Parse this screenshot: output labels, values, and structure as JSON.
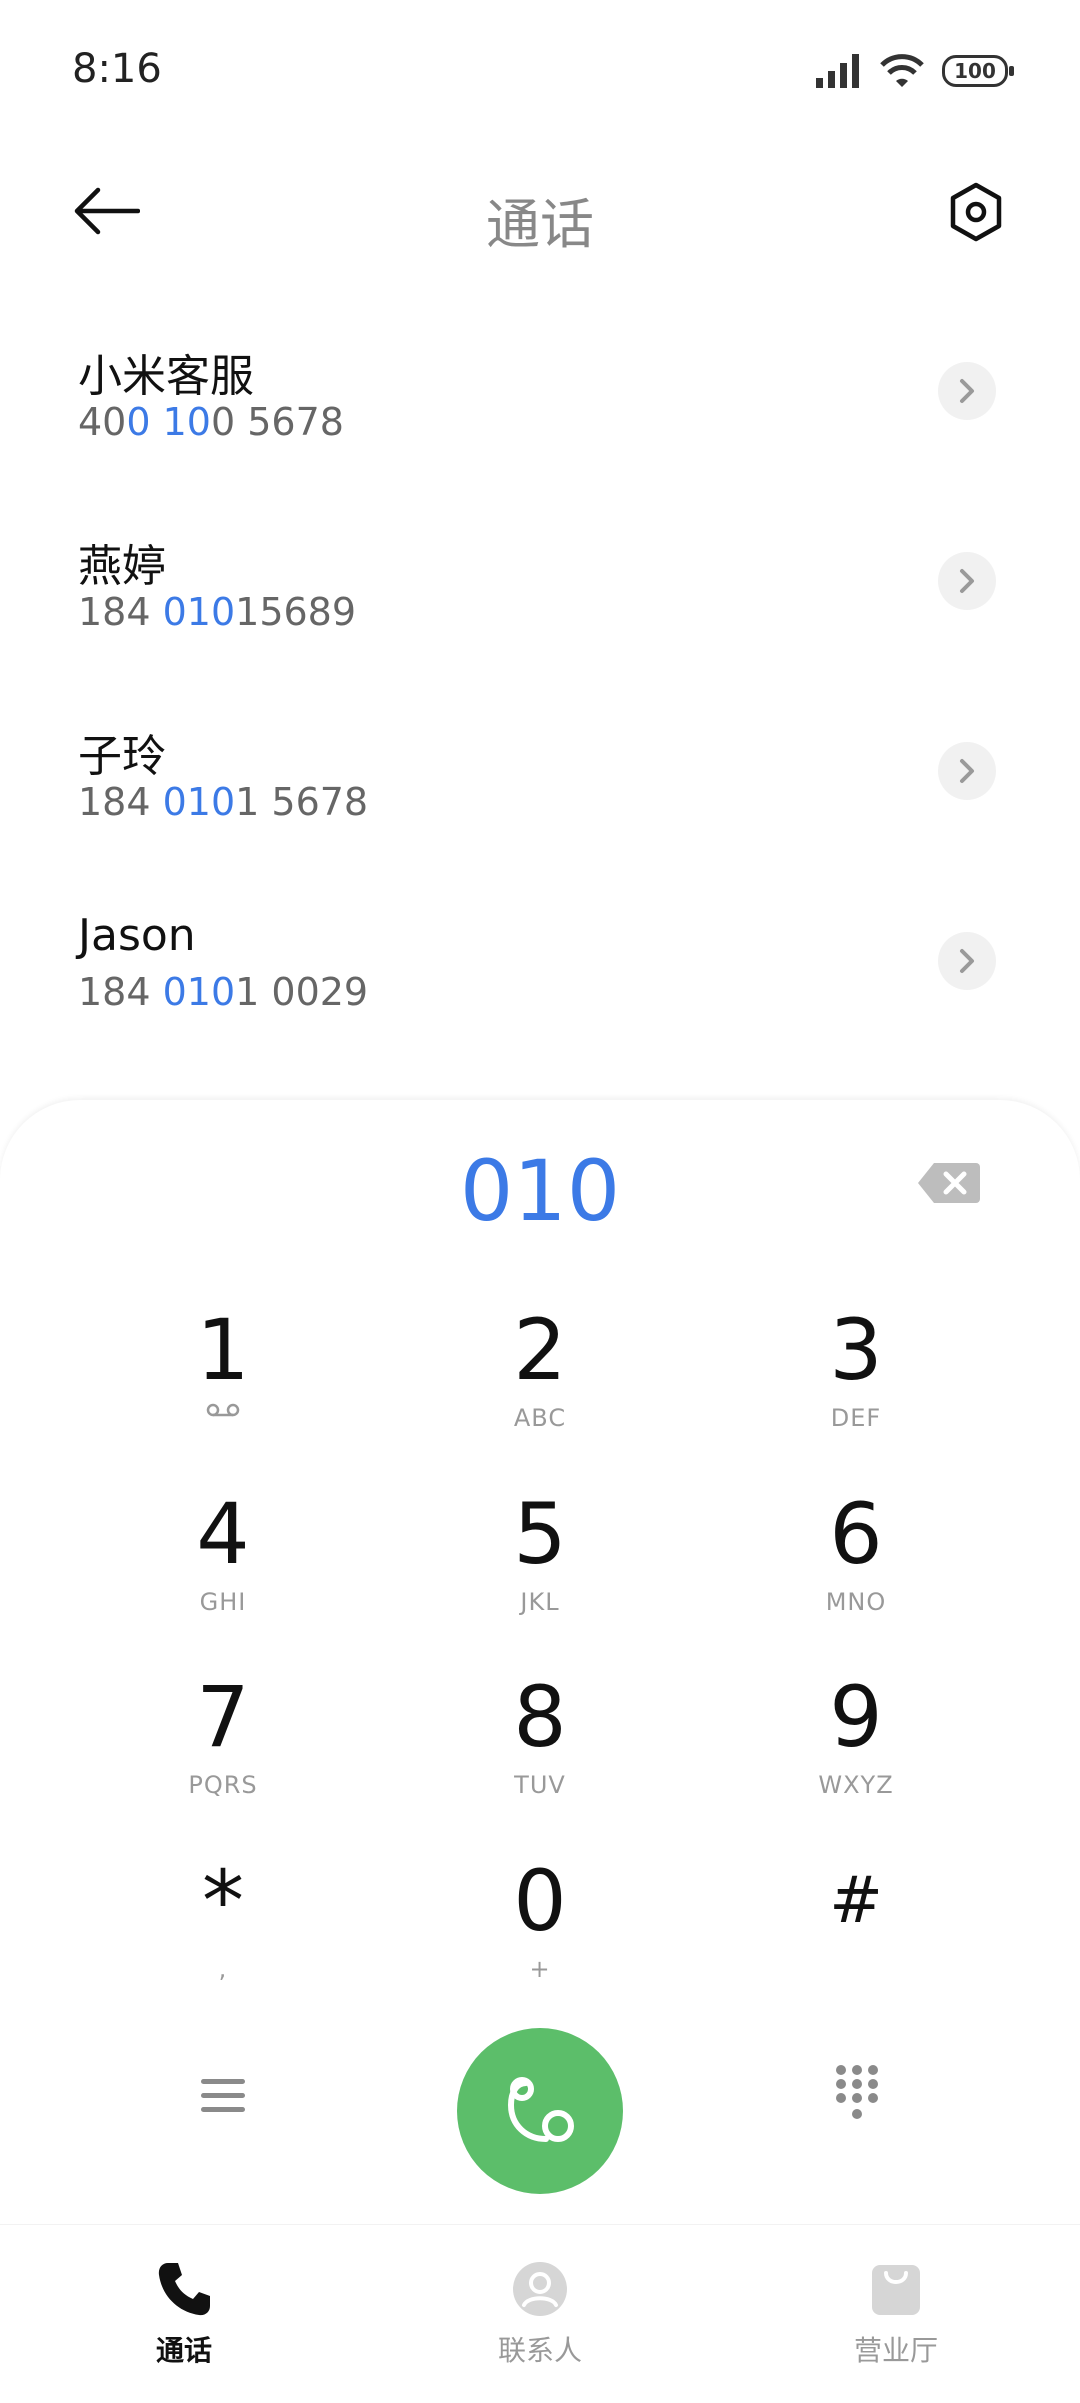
{
  "status": {
    "time": "8:16",
    "battery": "100"
  },
  "header": {
    "title": "通话"
  },
  "contacts": [
    {
      "name": "小米客服",
      "number_parts": [
        "40",
        "0 10",
        "0 5678"
      ]
    },
    {
      "name": "燕婷",
      "number_parts": [
        "184 ",
        "010",
        "15689"
      ]
    },
    {
      "name": "子玲",
      "number_parts": [
        "184 ",
        "010",
        "1 5678"
      ]
    },
    {
      "name": "Jason",
      "number_parts": [
        "184 ",
        "010",
        "1 0029"
      ]
    }
  ],
  "dialer": {
    "number": "010",
    "keys": [
      {
        "digit": "1",
        "letters": ""
      },
      {
        "digit": "2",
        "letters": "ABC"
      },
      {
        "digit": "3",
        "letters": "DEF"
      },
      {
        "digit": "4",
        "letters": "GHI"
      },
      {
        "digit": "5",
        "letters": "JKL"
      },
      {
        "digit": "6",
        "letters": "MNO"
      },
      {
        "digit": "7",
        "letters": "PQRS"
      },
      {
        "digit": "8",
        "letters": "TUV"
      },
      {
        "digit": "9",
        "letters": "WXYZ"
      },
      {
        "digit": "*",
        "letters": ","
      },
      {
        "digit": "0",
        "letters": "+"
      },
      {
        "digit": "#",
        "letters": ""
      }
    ],
    "voicemail_icon": "voicemail-icon"
  },
  "nav": {
    "calls": "通话",
    "contacts": "联系人",
    "store": "营业厅"
  },
  "colors": {
    "accent": "#3c7ae6",
    "call_green": "#5cbe6a"
  }
}
